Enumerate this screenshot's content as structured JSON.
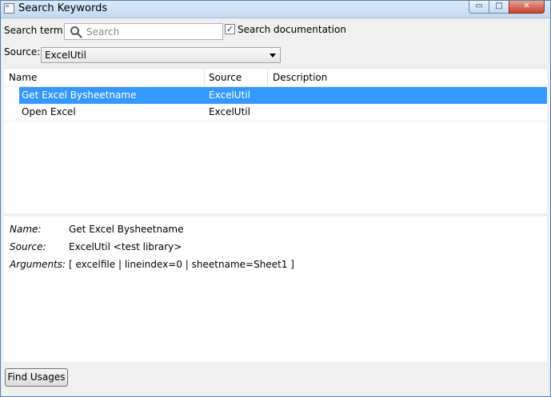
{
  "window": {
    "title": "Search Keywords",
    "min_glyph": "▭",
    "max_glyph": "□",
    "close_glyph": "✕"
  },
  "search": {
    "term_label": "Search term:",
    "placeholder": "Search",
    "search_doc_label": "Search documentation",
    "search_doc_checked": true,
    "check_glyph": "✓"
  },
  "source": {
    "label": "Source:",
    "selected": "ExcelUtil"
  },
  "table": {
    "columns": [
      "Name",
      "Source",
      "Description"
    ],
    "rows": [
      {
        "name": "Get Excel Bysheetname",
        "source": "ExcelUtil",
        "description": ""
      },
      {
        "name": "Open Excel",
        "source": "ExcelUtil",
        "description": ""
      }
    ],
    "selected_index": 0
  },
  "details": {
    "name_label": "Name:",
    "name_value": "Get Excel Bysheetname",
    "source_label": "Source:",
    "source_value": "ExcelUtil <test library>",
    "arguments_label": "Arguments:",
    "arguments_value": "[ excelfile | lineindex=0 | sheetname=Sheet1 ]"
  },
  "buttons": {
    "find_usages": "Find Usages"
  },
  "icons": {
    "search": "search-icon",
    "app": "app-icon",
    "dropdown": "chevron-down-icon"
  },
  "colors": {
    "selection": "#3399ff",
    "titlebar": "#c2d9f1"
  }
}
